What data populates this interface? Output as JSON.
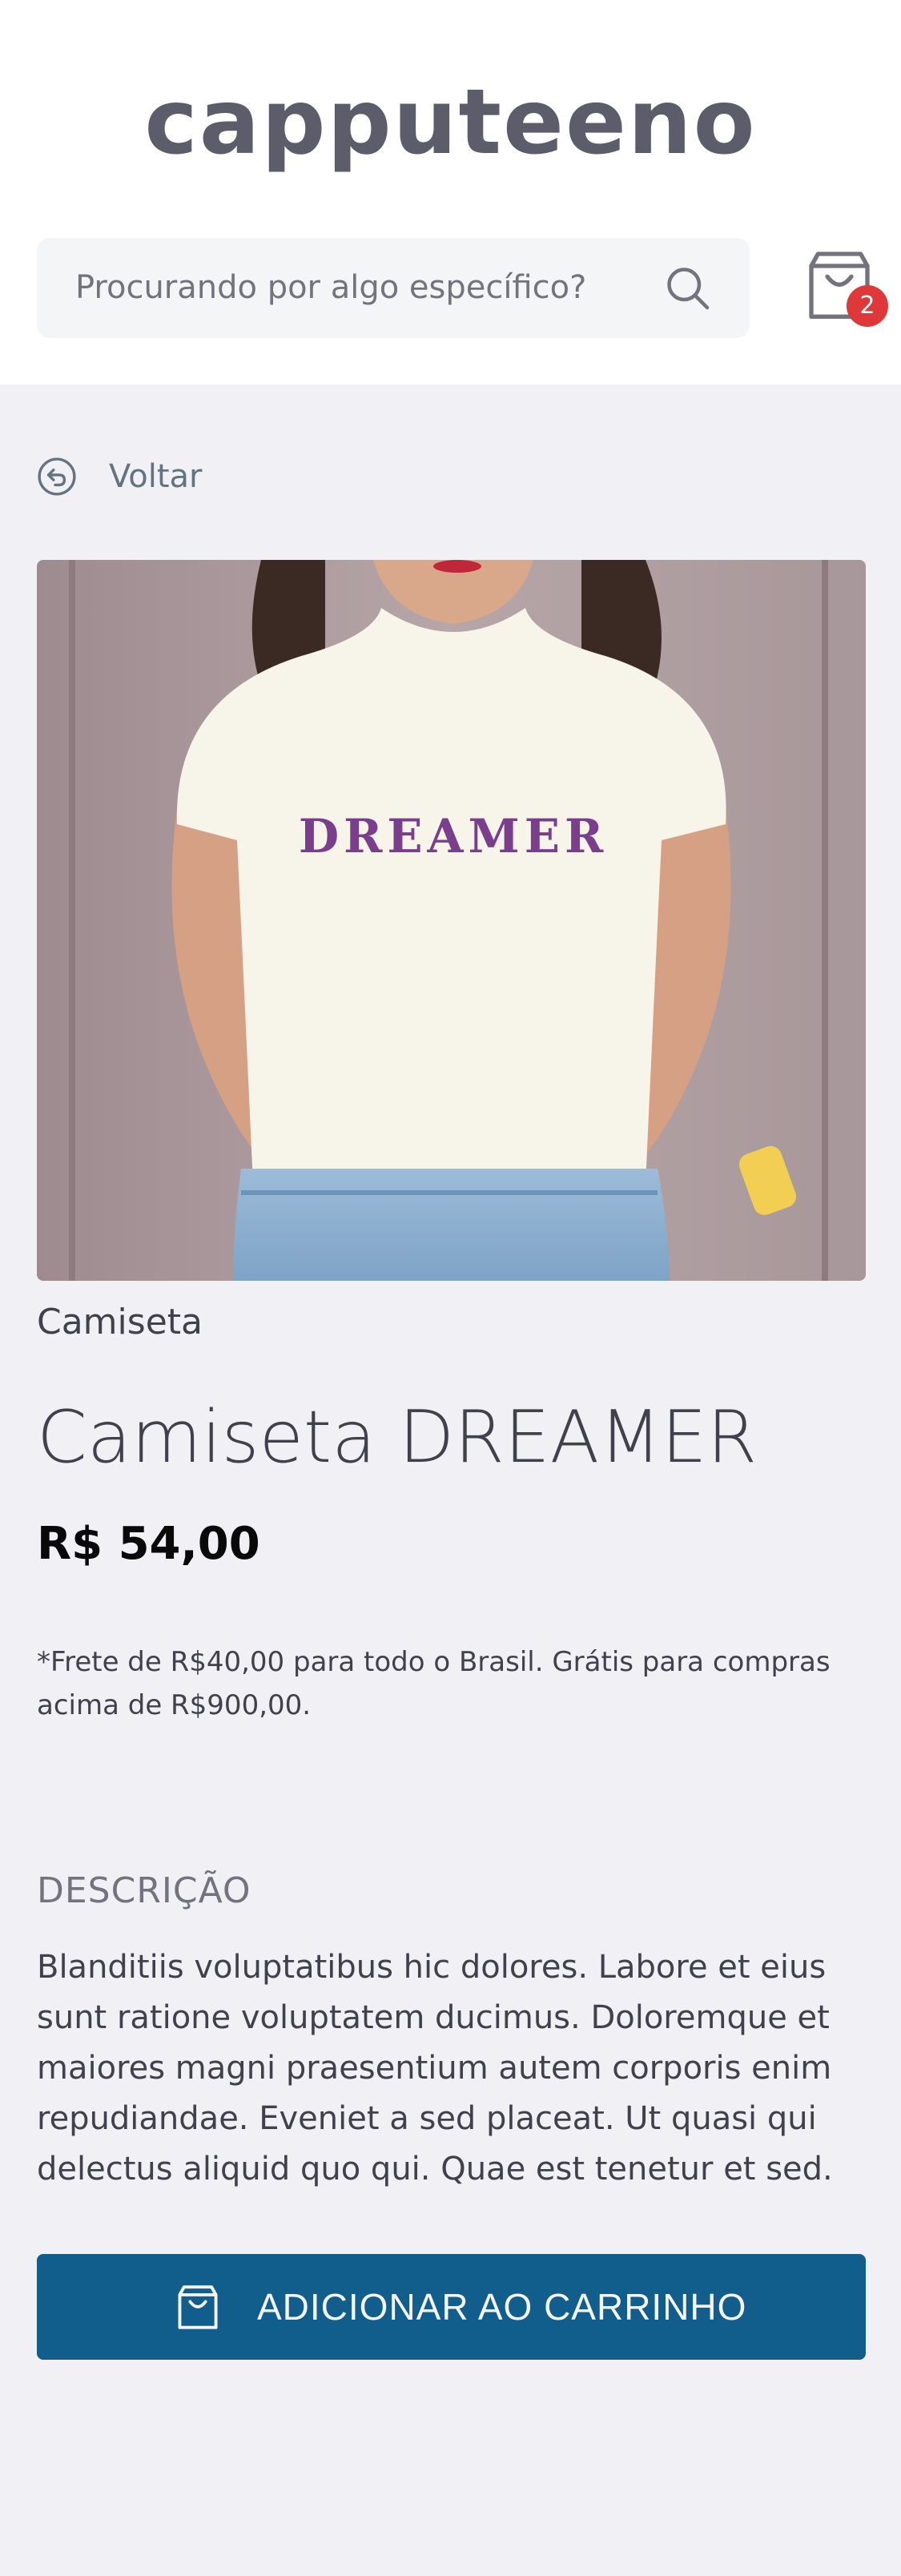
{
  "header": {
    "logo": "capputeeno",
    "search_placeholder": "Procurando por algo específico?",
    "search_icon": "search-icon",
    "cart_icon": "shopping-bag-icon",
    "cart_count": "2"
  },
  "nav": {
    "back_label": "Voltar",
    "back_icon": "back-arrow-icon"
  },
  "product": {
    "image_label": "DREAMER",
    "category": "Camiseta",
    "name": "Camiseta DREAMER",
    "price": "R$ 54,00",
    "shipping_note": "*Frete de R$40,00 para todo o Brasil. Grátis para compras acima de R$900,00.",
    "description_title": "DESCRIÇÃO",
    "description": "Blanditiis voluptatibus hic dolores. Labore et eius sunt ratione voluptatem ducimus. Doloremque et maiores magni praesentium autem corporis enim repudiandae. Eveniet a sed placeat. Ut quasi qui delectus aliquid quo qui. Quae est tenetur et sed.",
    "add_to_cart_label": "ADICIONAR AO CARRINHO"
  },
  "colors": {
    "primary_button": "#115d8c",
    "badge": "#de3838",
    "background": "#f0f0f5"
  }
}
